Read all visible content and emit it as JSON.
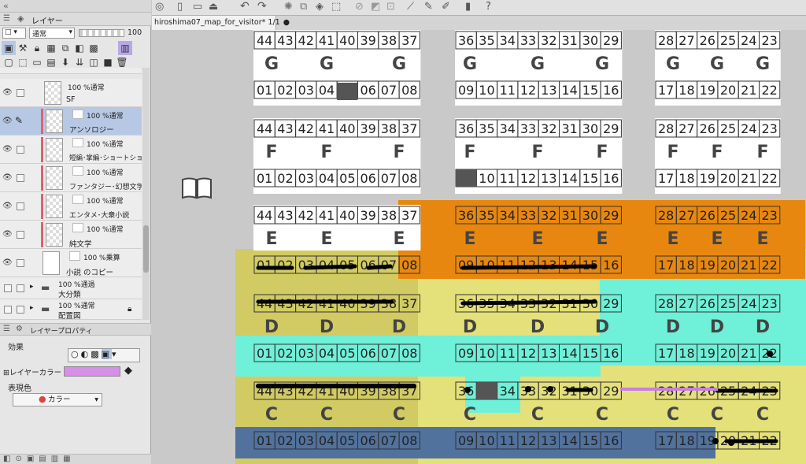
{
  "panel": {
    "layer_tab": "レイヤー",
    "blend_mode": "通常",
    "opacity": "100",
    "layers": [
      {
        "percent": "100 %通常",
        "name": "SF"
      },
      {
        "percent": "100 %通常",
        "name": "アンソロジー"
      },
      {
        "percent": "100 %通常",
        "name": "短編･掌編･ショートショート"
      },
      {
        "percent": "100 %通常",
        "name": "ファンタジー･幻想文学"
      },
      {
        "percent": "100 %通常",
        "name": "エンタメ･大衆小説"
      },
      {
        "percent": "100 %通常",
        "name": "純文学"
      },
      {
        "percent": "100 %乗算",
        "name": "小説 のコピー"
      },
      {
        "percent": "100 %通過",
        "name": "大分類"
      },
      {
        "percent": "100 %通常",
        "name": "配置図"
      }
    ],
    "props_tab": "レイヤープロパティ",
    "effect_label": "効果",
    "layer_color_label": "レイヤーカラー",
    "expression_label": "表現色",
    "expression_value": "カラー",
    "layer_color": "#d88fe8"
  },
  "document_tab": "hiroshima07_map_for_visitor* 1/1",
  "map": {
    "letters": [
      "G",
      "F",
      "E",
      "D",
      "C"
    ],
    "block1_top": [
      "44",
      "43",
      "42",
      "41",
      "40",
      "39",
      "38",
      "37"
    ],
    "block1_bottom": [
      "01",
      "02",
      "03",
      "04",
      "05",
      "06",
      "07",
      "08"
    ],
    "block2_top": [
      "36",
      "35",
      "34",
      "33",
      "32",
      "31",
      "30",
      "29"
    ],
    "block2_bottom": [
      "09",
      "10",
      "11",
      "12",
      "13",
      "14",
      "15",
      "16"
    ],
    "block3_top": [
      "28",
      "27",
      "26",
      "25",
      "24",
      "23"
    ],
    "block3_bottom": [
      "17",
      "18",
      "19",
      "20",
      "21",
      "22"
    ],
    "colors": {
      "orange": "#e8870f",
      "yellow": "#e4e07a",
      "olive": "#d2cb63",
      "cyan": "#6ff0d8",
      "blue": "#52729e",
      "purple": "#c97ee0"
    }
  }
}
